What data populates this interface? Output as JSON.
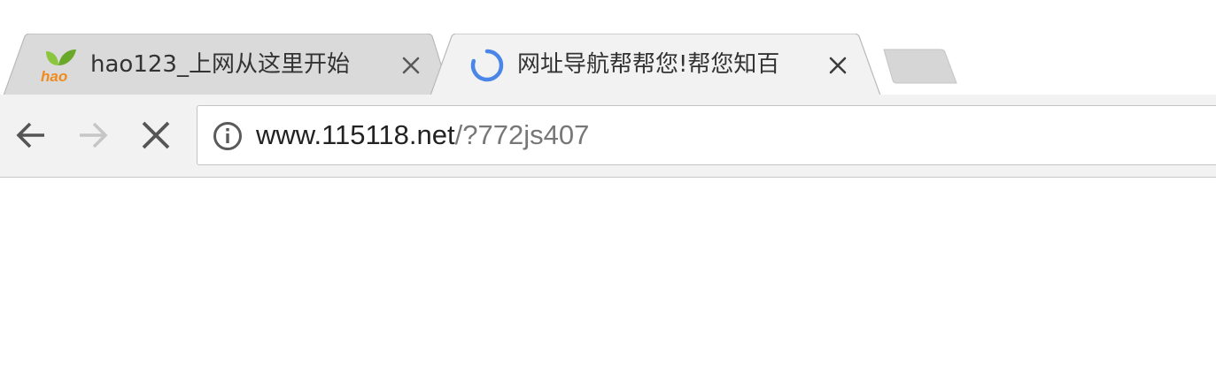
{
  "tabs": [
    {
      "title": "hao123_上网从这里开始",
      "favicon": "hao123-leaf-icon",
      "favicon_text": "hao",
      "active": false,
      "close_icon": "close-icon"
    },
    {
      "title": "网址导航帮帮您!帮您知百",
      "favicon": "loading-spinner-icon",
      "active": true,
      "close_icon": "close-icon"
    }
  ],
  "toolbar": {
    "back_icon": "arrow-left-icon",
    "forward_icon": "arrow-right-icon",
    "stop_icon": "stop-x-icon",
    "omnibox": {
      "security_icon": "info-icon",
      "url_host": "www.115118.net",
      "url_path": "/?772js407"
    }
  },
  "colors": {
    "tab_inactive": "#d9d9d9",
    "tab_active": "#f2f2f2",
    "toolbar": "#f2f2f2",
    "spinner": "#4a86e8",
    "leaf_green": "#7dbb2e",
    "hao_orange": "#f08a1c"
  }
}
